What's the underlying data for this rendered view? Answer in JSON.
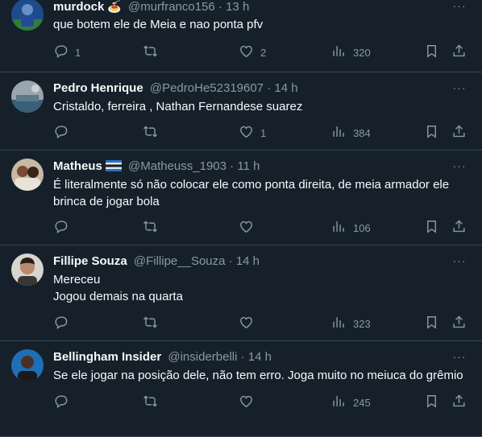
{
  "tweets": [
    {
      "name": "murdock",
      "badge": "🍝",
      "handle": "@murfranco156",
      "dot": "·",
      "time": "13 h",
      "text": [
        "que botem ele de Meia e nao ponta pfv"
      ],
      "replies": "1",
      "retweets": "",
      "likes": "2",
      "views": "320"
    },
    {
      "name": "Pedro Henrique",
      "badge": "",
      "handle": "@PedroHe52319607",
      "dot": "·",
      "time": "14 h",
      "text": [
        "Cristaldo, ferreira , Nathan Fernandese suarez"
      ],
      "replies": "",
      "retweets": "",
      "likes": "1",
      "views": "384"
    },
    {
      "name": "Matheus",
      "badge": "flag",
      "handle": "@Matheuss_1903",
      "dot": "·",
      "time": "11 h",
      "text": [
        "É literalmente só não colocar ele como ponta direita, de meia armador ele",
        "brinca de jogar bola"
      ],
      "replies": "",
      "retweets": "",
      "likes": "",
      "views": "106"
    },
    {
      "name": "Fillipe Souza",
      "badge": "",
      "handle": "@Fillipe__Souza",
      "dot": "·",
      "time": "14 h",
      "text": [
        "Mereceu",
        "Jogou demais na quarta"
      ],
      "replies": "",
      "retweets": "",
      "likes": "",
      "views": "323"
    },
    {
      "name": "Bellingham Insider",
      "badge": "",
      "handle": "@insiderbelli",
      "dot": "·",
      "time": "14 h",
      "text": [
        "Se ele jogar na posição dele, não tem erro. Joga muito no meiuca do grêmio"
      ],
      "replies": "",
      "retweets": "",
      "likes": "",
      "views": "245"
    }
  ],
  "more_icon": "···",
  "colors": {
    "background": "#15202b",
    "text": "#f7f9f9",
    "secondary": "#8b98a5",
    "divider": "#38444d"
  }
}
